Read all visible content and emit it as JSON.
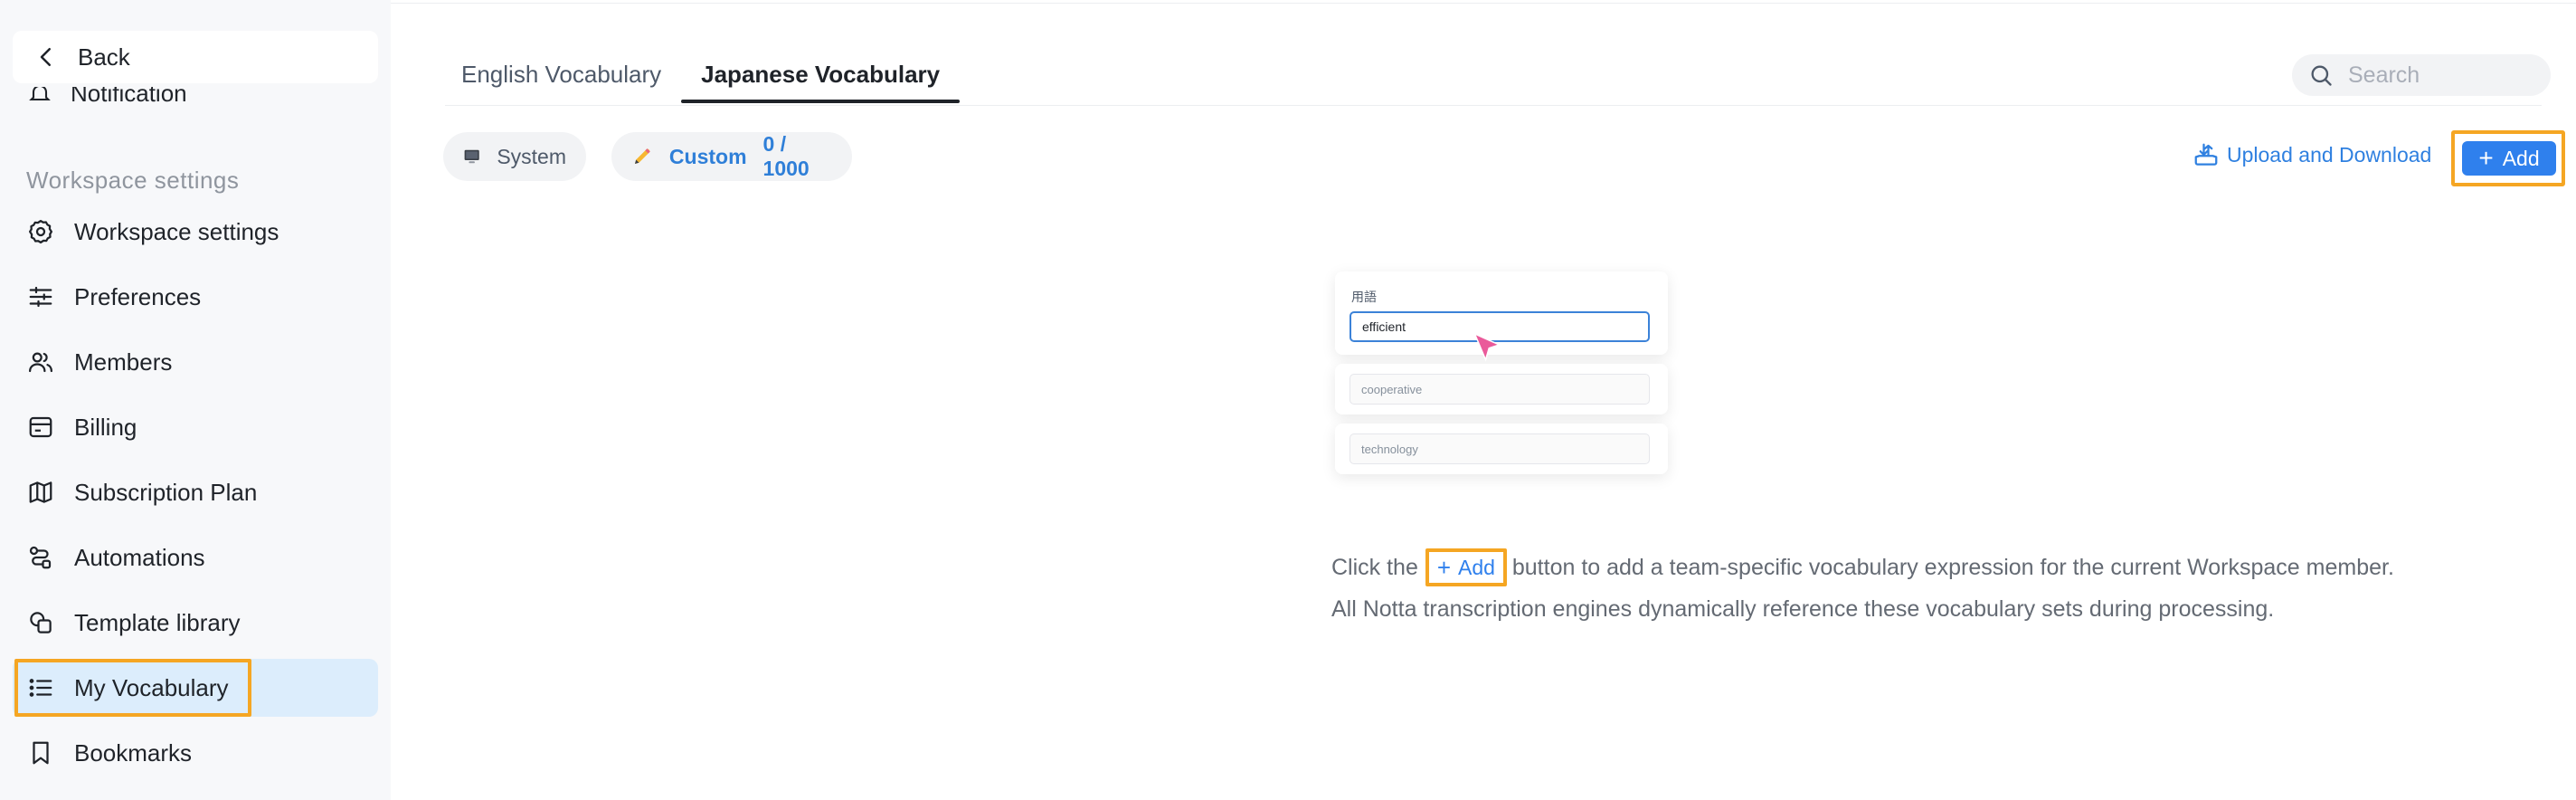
{
  "sidebar": {
    "back_label": "Back",
    "cut_item_label": "Notification",
    "section_title": "Workspace settings",
    "items": [
      {
        "label": "Workspace settings",
        "icon": "gear-icon"
      },
      {
        "label": "Preferences",
        "icon": "sliders-icon"
      },
      {
        "label": "Members",
        "icon": "members-icon"
      },
      {
        "label": "Billing",
        "icon": "billing-icon"
      },
      {
        "label": "Subscription Plan",
        "icon": "map-icon"
      },
      {
        "label": "Automations",
        "icon": "automation-icon"
      },
      {
        "label": "Template library",
        "icon": "template-icon"
      },
      {
        "label": "My Vocabulary",
        "icon": "list-icon",
        "active": true
      },
      {
        "label": "Bookmarks",
        "icon": "bookmark-icon"
      }
    ]
  },
  "tabs": [
    {
      "label": "English Vocabulary",
      "active": false
    },
    {
      "label": "Japanese Vocabulary",
      "active": true
    }
  ],
  "search": {
    "placeholder": "Search"
  },
  "filters": {
    "system_label": "System",
    "custom_label": "Custom",
    "custom_count": "0 / 1000"
  },
  "actions": {
    "upload_label": "Upload and Download",
    "add_label": "Add"
  },
  "illustration": {
    "term_label": "用語",
    "field1": "efficient",
    "field2": "cooperative",
    "field3": "technology"
  },
  "empty_state": {
    "line1_before": "Click the",
    "add_label": "Add",
    "line1_after": "button to add a team-specific vocabulary expression for the current Workspace member.",
    "line2": "All Notta transcription engines dynamically reference these vocabulary sets during processing."
  },
  "colors": {
    "accent": "#2f80ed",
    "highlight": "#f5a623",
    "active_bg": "#dcedfc"
  }
}
